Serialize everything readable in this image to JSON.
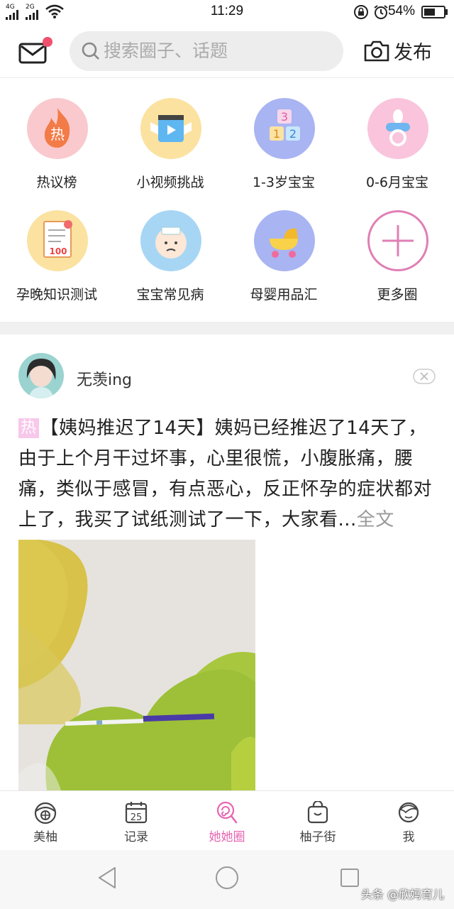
{
  "status_bar": {
    "signal_1": "4G",
    "signal_2": "2G",
    "time": "11:29",
    "battery": "54%"
  },
  "header": {
    "search_placeholder": "搜索圈子、话题",
    "publish_label": "发布",
    "notification_color": "#f0506e"
  },
  "categories": [
    {
      "label": "热议榜",
      "icon": "flame-icon",
      "color": "#f9c9cd",
      "glyph": "热"
    },
    {
      "label": "小视频挑战",
      "icon": "video-play-icon",
      "color": "#fbe2a0"
    },
    {
      "label": "1-3岁宝宝",
      "icon": "number-blocks-icon",
      "color": "#a9b4f2"
    },
    {
      "label": "0-6月宝宝",
      "icon": "pacifier-icon",
      "color": "#f9c4dc"
    },
    {
      "label": "孕晚知识测试",
      "icon": "exam-paper-icon",
      "color": "#fbe2a0"
    },
    {
      "label": "宝宝常见病",
      "icon": "sick-baby-icon",
      "color": "#a7d6f5"
    },
    {
      "label": "母婴用品汇",
      "icon": "stroller-icon",
      "color": "#a9b4f2"
    },
    {
      "label": "更多圈",
      "icon": "plus-circle-icon",
      "color": "#e07fb4"
    }
  ],
  "post": {
    "username": "无羡ing",
    "hot_tag": "热",
    "title": "【姨妈推迟了14天】",
    "body": "姨妈已经推迟了14天了，由于上个月干过坏事，心里很慌，小腹胀痛，腰痛，类似于感冒，有点恶心，反正怀孕的症状都对上了，我买了试纸测试了一下，大家看...",
    "full_text": "全文"
  },
  "tabs": [
    {
      "label": "美柚",
      "icon": "grapefruit-icon",
      "active": false
    },
    {
      "label": "记录",
      "icon": "calendar-icon",
      "active": false,
      "badge": "25"
    },
    {
      "label": "她她圈",
      "icon": "lollipop-icon",
      "active": true
    },
    {
      "label": "柚子街",
      "icon": "shopping-bag-icon",
      "active": false
    },
    {
      "label": "我",
      "icon": "profile-icon",
      "active": false
    }
  ],
  "watermark": "头条 @欣妈育儿",
  "colors": {
    "accent": "#e765b2",
    "active_tab": "#e765b2"
  }
}
